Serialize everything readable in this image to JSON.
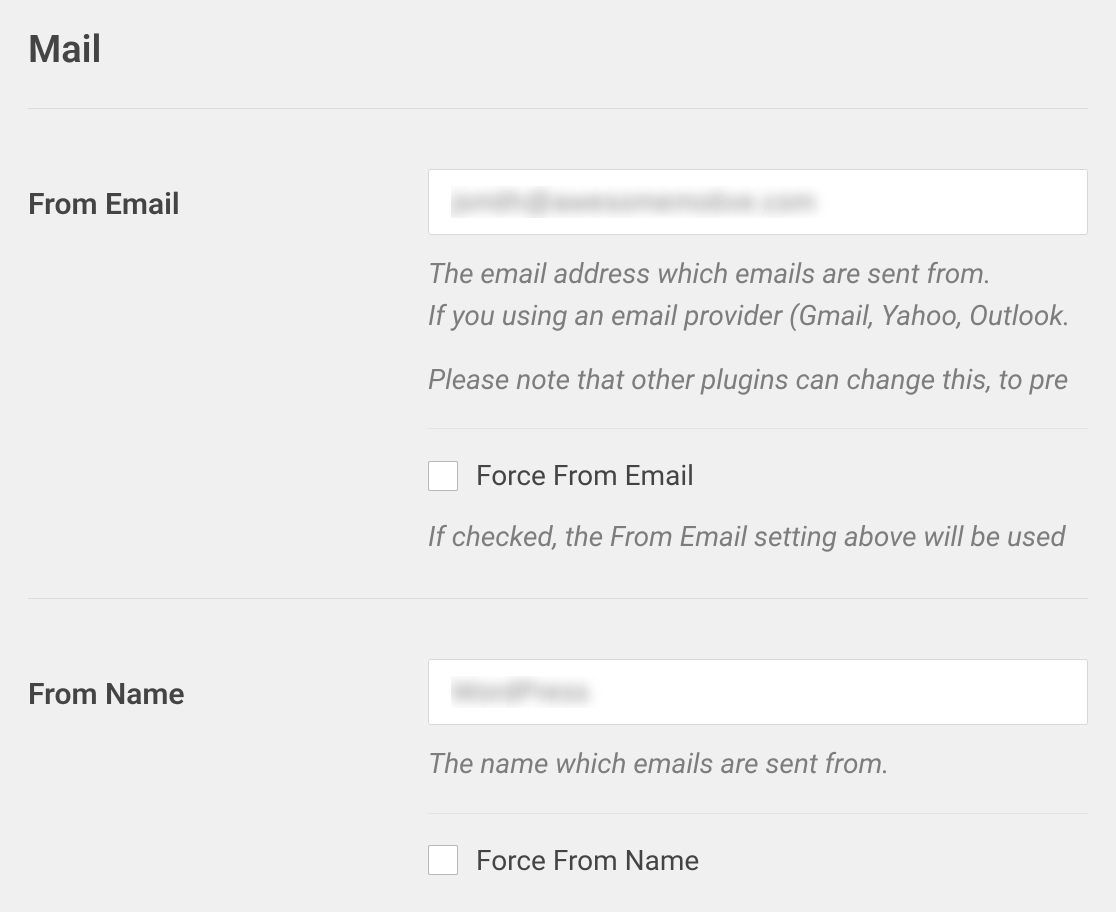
{
  "section": {
    "title": "Mail"
  },
  "from_email": {
    "label": "From Email",
    "value": "jsmith@awesomemotive.com",
    "desc_line1": "The email address which emails are sent from.",
    "desc_line2": "If you using an email provider (Gmail, Yahoo, Outlook.",
    "desc_line3": "Please note that other plugins can change this, to pre",
    "force_label": "Force From Email",
    "force_desc": "If checked, the From Email setting above will be used"
  },
  "from_name": {
    "label": "From Name",
    "value": "WordPress",
    "desc_line1": "The name which emails are sent from.",
    "force_label": "Force From Name"
  }
}
